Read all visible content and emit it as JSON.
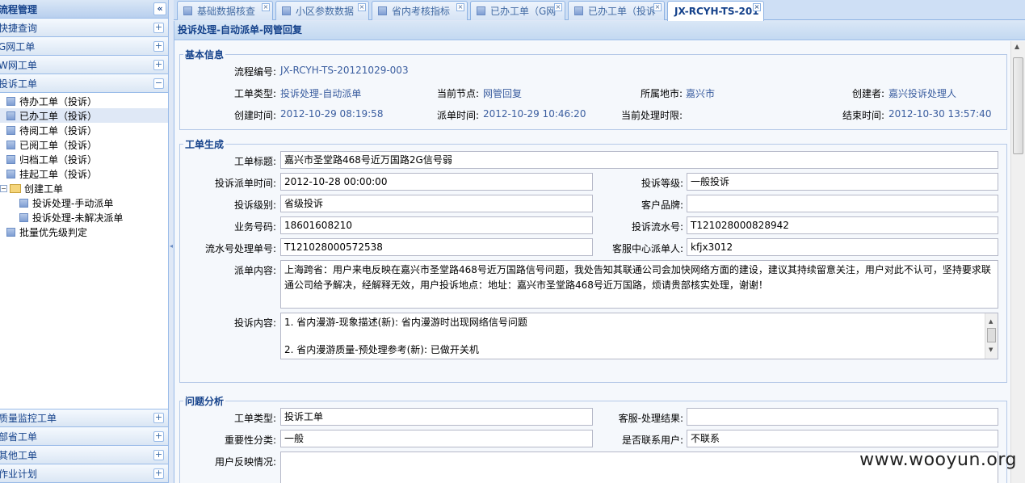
{
  "sidebar": {
    "title": "流程管理",
    "collapse_icon": "«",
    "sections_top": [
      {
        "label": "快捷查询",
        "toggle": "+"
      },
      {
        "label": "G网工单",
        "toggle": "+"
      },
      {
        "label": "W网工单",
        "toggle": "+"
      },
      {
        "label": "投诉工单",
        "toggle": "−"
      }
    ],
    "tree": [
      {
        "label": "待办工单（投诉）"
      },
      {
        "label": "已办工单（投诉）"
      },
      {
        "label": "待阅工单（投诉）"
      },
      {
        "label": "已阅工单（投诉）"
      },
      {
        "label": "归档工单（投诉）"
      },
      {
        "label": "挂起工单（投诉）"
      },
      {
        "label": "创建工单",
        "toggle": "−"
      },
      {
        "label": "投诉处理-手动派单"
      },
      {
        "label": "投诉处理-未解决派单"
      },
      {
        "label": "批量优先级判定"
      }
    ],
    "sections_bottom": [
      {
        "label": "质量监控工单",
        "toggle": "+"
      },
      {
        "label": "部省工单",
        "toggle": "+"
      },
      {
        "label": "其他工单",
        "toggle": "+"
      },
      {
        "label": "作业计划",
        "toggle": "+"
      }
    ]
  },
  "tabs": [
    {
      "label": "基础数据核查"
    },
    {
      "label": "小区参数数据"
    },
    {
      "label": "省内考核指标"
    },
    {
      "label": "已办工单（G网"
    },
    {
      "label": "已办工单（投诉"
    },
    {
      "label": "JX-RCYH-TS-201"
    }
  ],
  "tab_close": "×",
  "panel_title": "投诉处理-自动派单-网管回复",
  "basic": {
    "legend": "基本信息",
    "flow_no_label": "流程编号:",
    "flow_no": "JX-RCYH-TS-20121029-003",
    "type_label": "工单类型:",
    "type": "投诉处理-自动派单",
    "node_label": "当前节点:",
    "node": "网管回复",
    "city_label": "所属地市:",
    "city": "嘉兴市",
    "creator_label": "创建者:",
    "creator": "嘉兴投诉处理人",
    "created_label": "创建时间:",
    "created": "2012-10-29 08:19:58",
    "dispatch_label": "派单时间:",
    "dispatch": "2012-10-29 10:46:20",
    "deadline_label": "当前处理时限:",
    "deadline": "",
    "end_label": "结束时间:",
    "end": "2012-10-30 13:57:40"
  },
  "gen": {
    "legend": "工单生成",
    "title_label": "工单标题:",
    "title": "嘉兴市圣堂路468号近万国路2G信号弱",
    "ctime_label": "投诉派单时间:",
    "ctime": "2012-10-28 00:00:00",
    "grade_label": "投诉等级:",
    "grade": "一般投诉",
    "level_label": "投诉级别:",
    "level": "省级投诉",
    "brand_label": "客户品牌:",
    "brand": "",
    "biz_label": "业务号码:",
    "biz": "18601608210",
    "serial_label": "投诉流水号:",
    "serial": "T121028000828942",
    "proc_label": "流水号处理单号:",
    "proc": "T121028000572538",
    "agent_label": "客服中心派单人:",
    "agent": "kfjx3012",
    "content_label": "派单内容:",
    "content": "上海跨省：用户来电反映在嘉兴市圣堂路468号近万国路信号问题，我处告知其联通公司会加快网络方面的建设，建议其持续留意关注，用户对此不认可，坚持要求联通公司给予解决，经解释无效，用户投诉地点：地址：嘉兴市圣堂路468号近万国路，烦请贵部核实处理，谢谢！",
    "complaint_label": "投诉内容:",
    "complaint_line1": "1. 省内漫游-现象描述(新): 省内漫游时出现网络信号问题",
    "complaint_line2": "2. 省内漫游质量-预处理参考(新): 已做开关机"
  },
  "analysis": {
    "legend": "问题分析",
    "type_label": "工单类型:",
    "type": "投诉工单",
    "result_label": "客服-处理结果:",
    "result": "",
    "importance_label": "重要性分类:",
    "importance": "一般",
    "contact_label": "是否联系用户:",
    "contact": "不联系",
    "feedback_label": "用户反映情况:",
    "feedback": ""
  },
  "watermark": "www.wooyun.org"
}
